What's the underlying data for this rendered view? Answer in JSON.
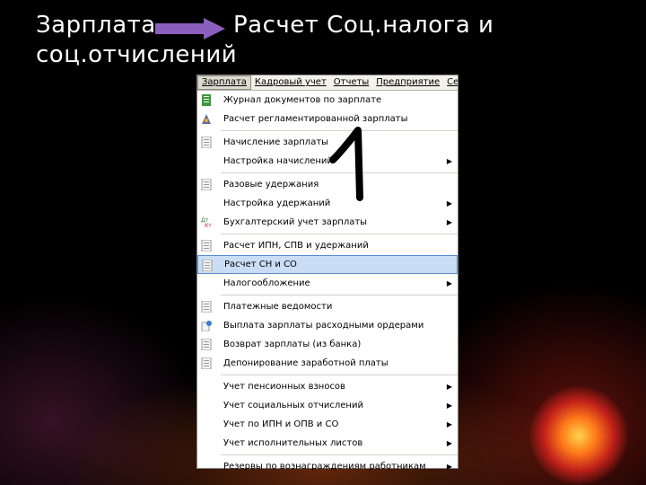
{
  "slide": {
    "title_left": "Зарплата",
    "title_right": "Расчет Соц.налога и",
    "title_line2": "соц.отчислений",
    "arrow_color": "#8a5fbf",
    "annotation": "1"
  },
  "menubar": {
    "items": [
      "Зарплата",
      "Кадровый учет",
      "Отчеты",
      "Предприятие",
      "Сервис"
    ]
  },
  "menu": {
    "items": [
      {
        "label": "Журнал документов по зарплате",
        "icon": "journal-icon",
        "submenu": false
      },
      {
        "label": "Расчет регламентированной зарплаты",
        "icon": "calculation-icon",
        "submenu": false
      },
      {
        "label": "Начисление зарплаты",
        "icon": "document-icon",
        "submenu": false
      },
      {
        "label": "Настройка начислений",
        "icon": "none",
        "submenu": true
      },
      {
        "label": "Разовые удержания",
        "icon": "document-icon",
        "submenu": false
      },
      {
        "label": "Настройка удержаний",
        "icon": "none",
        "submenu": true
      },
      {
        "label": "Бухгалтерский учет зарплаты",
        "icon": "dt-kt-icon",
        "submenu": true
      },
      {
        "label": "Расчет ИПН, СПВ и удержаний",
        "icon": "document-icon",
        "submenu": false
      },
      {
        "label": "Расчет СН и СО",
        "icon": "document-icon",
        "submenu": false,
        "selected": true
      },
      {
        "label": "Налогообложение",
        "icon": "none",
        "submenu": true
      },
      {
        "label": "Платежные ведомости",
        "icon": "document-icon",
        "submenu": false
      },
      {
        "label": "Выплата зарплаты расходными ордерами",
        "icon": "payout-icon",
        "submenu": false
      },
      {
        "label": "Возврат зарплаты (из банка)",
        "icon": "document-icon",
        "submenu": false
      },
      {
        "label": "Депонирование заработной платы",
        "icon": "document-icon",
        "submenu": false
      },
      {
        "label": "Учет пенсионных взносов",
        "icon": "none",
        "submenu": true
      },
      {
        "label": "Учет социальных отчислений",
        "icon": "none",
        "submenu": true
      },
      {
        "label": "Учет по ИПН и ОПВ и СО",
        "icon": "none",
        "submenu": true
      },
      {
        "label": "Учет исполнительных листов",
        "icon": "none",
        "submenu": true
      },
      {
        "label": "Резервы по вознаграждениям работникам",
        "icon": "none",
        "submenu": true
      }
    ]
  }
}
